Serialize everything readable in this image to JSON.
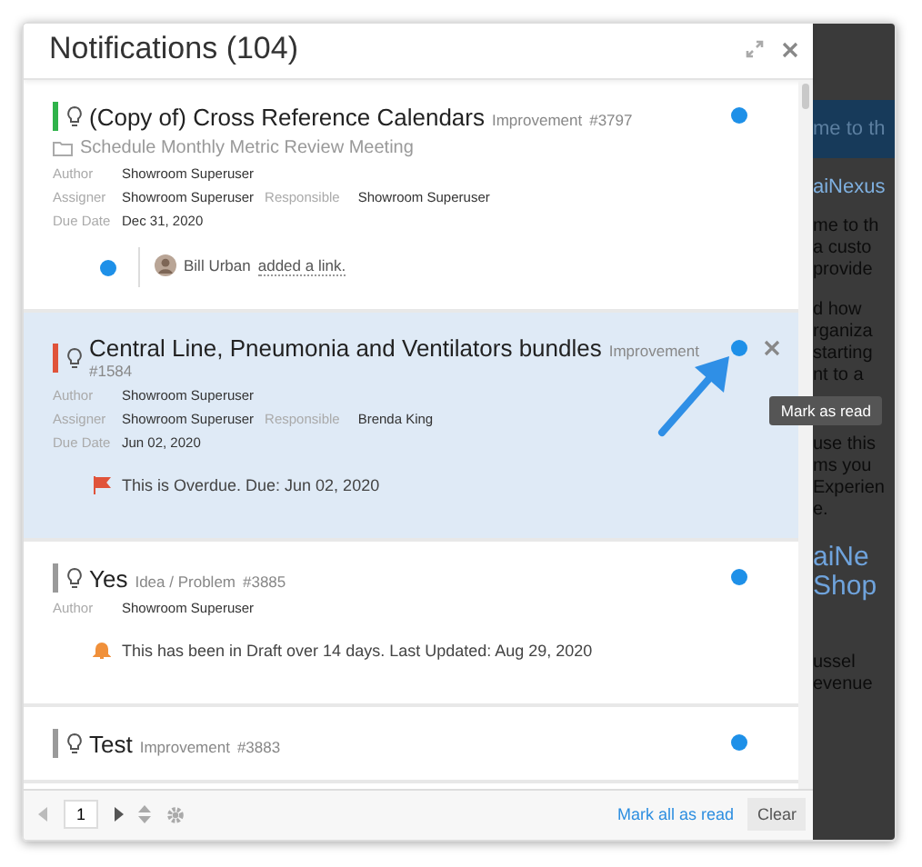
{
  "panel": {
    "title": "Notifications (104)"
  },
  "notifications": [
    {
      "color": "#2fb34a",
      "title": "(Copy of) Cross Reference Calendars",
      "type": "Improvement",
      "number": "#3797",
      "unread": true,
      "selected": false,
      "folder": "Schedule Monthly Metric Review Meeting",
      "field_rows": [
        [
          {
            "label": "Author",
            "value": "Showroom Superuser"
          }
        ],
        [
          {
            "label": "Assigner",
            "value": "Showroom Superuser"
          },
          {
            "label": "Responsible",
            "value": "Showroom Superuser"
          }
        ],
        [
          {
            "label": "Due Date",
            "value": "Dec 31, 2020"
          }
        ]
      ],
      "activity": {
        "unread": true,
        "user": "Bill Urban",
        "action": "added a link."
      }
    },
    {
      "color": "#e0533a",
      "title": "Central Line, Pneumonia and Ventilators bundles",
      "type": "Improvement",
      "number": "#1584",
      "unread": true,
      "selected": true,
      "field_rows": [
        [
          {
            "label": "Author",
            "value": "Showroom Superuser"
          }
        ],
        [
          {
            "label": "Assigner",
            "value": "Showroom Superuser"
          },
          {
            "label": "Responsible",
            "value": "Brenda King"
          }
        ],
        [
          {
            "label": "Due Date",
            "value": "Jun 02, 2020"
          }
        ]
      ],
      "alert": {
        "kind": "flag",
        "text": "This is Overdue. Due: Jun 02, 2020"
      },
      "tooltip": "Mark as read"
    },
    {
      "color": "#9a9a9a",
      "title": "Yes",
      "type": "Idea / Problem",
      "number": "#3885",
      "unread": true,
      "selected": false,
      "field_rows": [
        [
          {
            "label": "Author",
            "value": "Showroom Superuser"
          }
        ]
      ],
      "alert": {
        "kind": "bell",
        "text": "This has been in Draft over 14 days. Last Updated: Aug 29, 2020"
      }
    },
    {
      "color": "#9a9a9a",
      "title": "Test",
      "type": "Improvement",
      "number": "#3883",
      "unread": true,
      "selected": false
    }
  ],
  "footer": {
    "page": "1",
    "mark_all": "Mark all as read",
    "clear": "Clear"
  },
  "background_page": {
    "banner": "me to th",
    "heading": "aiNexus",
    "paragraph_1": [
      "me to th",
      "a custo",
      "provide"
    ],
    "paragraph_2": [
      "d how",
      "rganiza",
      "starting",
      "nt to a"
    ],
    "paragraph_3": [
      "use this",
      "ms you",
      "Experien",
      "e."
    ],
    "big_heading": [
      "aiNe",
      "Shop"
    ],
    "paragraph_4": [
      "ussel",
      "evenue"
    ]
  }
}
